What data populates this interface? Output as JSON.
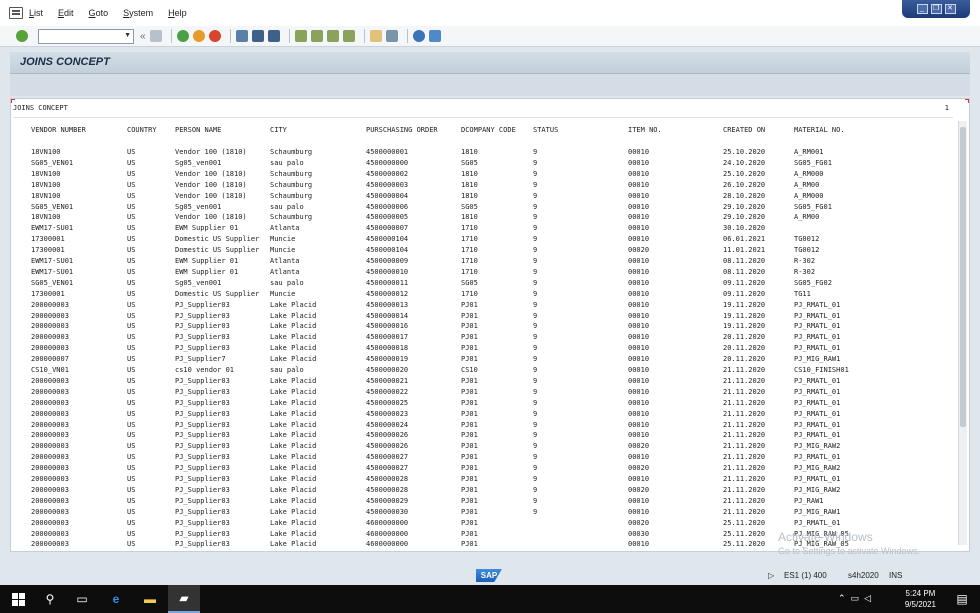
{
  "menu": [
    "List",
    "Edit",
    "Goto",
    "System",
    "Help"
  ],
  "window_controls": [
    "_",
    "❐",
    "✕"
  ],
  "page_title": "JOINS CONCEPT",
  "list": {
    "heading": "JOINS CONCEPT",
    "page_number": "1",
    "columns": [
      "VENDOR NUMBER",
      "COUNTRY",
      "PERSON NAME",
      "CITY",
      "PURSCHASING ORDER",
      "DCOMPANY CODE",
      "STATUS",
      "ITEM NO.",
      "CREATED ON",
      "MATERIAL NO."
    ],
    "rows": [
      [
        "18VN100",
        "US",
        "Vendor 100 (1810)",
        "Schaumburg",
        "4500000001",
        "1810",
        "9",
        "00010",
        "25.10.2020",
        "A_RM001"
      ],
      [
        "SG05_VEN01",
        "US",
        "Sg05_ven001",
        "sau palo",
        "4500000000",
        "SG05",
        "9",
        "00010",
        "24.10.2020",
        "SG05_FG01"
      ],
      [
        "18VN100",
        "US",
        "Vendor 100 (1810)",
        "Schaumburg",
        "4500000002",
        "1810",
        "9",
        "00010",
        "25.10.2020",
        "A_RM000"
      ],
      [
        "18VN100",
        "US",
        "Vendor 100 (1810)",
        "Schaumburg",
        "4500000003",
        "1810",
        "9",
        "00010",
        "26.10.2020",
        "A_RM00"
      ],
      [
        "18VN100",
        "US",
        "Vendor 100 (1810)",
        "Schaumburg",
        "4500000004",
        "1810",
        "9",
        "00010",
        "28.10.2020",
        "A_RM000"
      ],
      [
        "SG05_VEN01",
        "US",
        "Sg05_ven001",
        "sau palo",
        "4500000006",
        "SG05",
        "9",
        "00010",
        "29.10.2020",
        "SG05_FG01"
      ],
      [
        "18VN100",
        "US",
        "Vendor 100 (1810)",
        "Schaumburg",
        "4500000005",
        "1810",
        "9",
        "00010",
        "29.10.2020",
        "A_RM00"
      ],
      [
        "EWM17-SU01",
        "US",
        "EWM Supplier 01",
        "Atlanta",
        "4500000007",
        "1710",
        "9",
        "00010",
        "30.10.2020",
        ""
      ],
      [
        "17300001",
        "US",
        "Domestic US Supplier",
        "Muncie",
        "4500000104",
        "1710",
        "9",
        "00010",
        "06.01.2021",
        "TG0012"
      ],
      [
        "17300001",
        "US",
        "Domestic US Supplier",
        "Muncie",
        "4500000104",
        "1710",
        "9",
        "00020",
        "11.01.2021",
        "TG0012"
      ],
      [
        "EWM17-SU01",
        "US",
        "EWM Supplier 01",
        "Atlanta",
        "4500000009",
        "1710",
        "9",
        "00010",
        "08.11.2020",
        "R-302"
      ],
      [
        "EWM17-SU01",
        "US",
        "EWM Supplier 01",
        "Atlanta",
        "4500000010",
        "1710",
        "9",
        "00010",
        "08.11.2020",
        "R-302"
      ],
      [
        "SG05_VEN01",
        "US",
        "Sg05_ven001",
        "sau palo",
        "4500000011",
        "SG05",
        "9",
        "00010",
        "09.11.2020",
        "SG05_FG02"
      ],
      [
        "17300001",
        "US",
        "Domestic US Supplier",
        "Muncie",
        "4500000012",
        "1710",
        "9",
        "00010",
        "09.11.2020",
        "TG11"
      ],
      [
        "200000003",
        "US",
        "PJ_Supplier03",
        "Lake Placid",
        "4500000013",
        "PJ01",
        "9",
        "00010",
        "19.11.2020",
        "PJ_RMATL_01"
      ],
      [
        "200000003",
        "US",
        "PJ_Supplier03",
        "Lake Placid",
        "4500000014",
        "PJ01",
        "9",
        "00010",
        "19.11.2020",
        "PJ_RMATL_01"
      ],
      [
        "200000003",
        "US",
        "PJ_Supplier03",
        "Lake Placid",
        "4500000016",
        "PJ01",
        "9",
        "00010",
        "19.11.2020",
        "PJ_RMATL_01"
      ],
      [
        "200000003",
        "US",
        "PJ_Supplier03",
        "Lake Placid",
        "4500000017",
        "PJ01",
        "9",
        "00010",
        "20.11.2020",
        "PJ_RMATL_01"
      ],
      [
        "200000003",
        "US",
        "PJ_Supplier03",
        "Lake Placid",
        "4500000018",
        "PJ01",
        "9",
        "00010",
        "20.11.2020",
        "PJ_RMATL_01"
      ],
      [
        "200000007",
        "US",
        "PJ_Supplier7",
        "Lake Placid",
        "4500000019",
        "PJ01",
        "9",
        "00010",
        "20.11.2020",
        "PJ_MIG_RAW1"
      ],
      [
        "CS10_VN01",
        "US",
        "cs10 vendor 01",
        "sau palo",
        "4500000020",
        "CS10",
        "9",
        "00010",
        "21.11.2020",
        "CS10_FINISH01"
      ],
      [
        "200000003",
        "US",
        "PJ_Supplier03",
        "Lake Placid",
        "4500000021",
        "PJ01",
        "9",
        "00010",
        "21.11.2020",
        "PJ_RMATL_01"
      ],
      [
        "200000003",
        "US",
        "PJ_Supplier03",
        "Lake Placid",
        "4500000022",
        "PJ01",
        "9",
        "00010",
        "21.11.2020",
        "PJ_RMATL_01"
      ],
      [
        "200000003",
        "US",
        "PJ_Supplier03",
        "Lake Placid",
        "4500000025",
        "PJ01",
        "9",
        "00010",
        "21.11.2020",
        "PJ_RMATL_01"
      ],
      [
        "200000003",
        "US",
        "PJ_Supplier03",
        "Lake Placid",
        "4500000023",
        "PJ01",
        "9",
        "00010",
        "21.11.2020",
        "PJ_RMATL_01"
      ],
      [
        "200000003",
        "US",
        "PJ_Supplier03",
        "Lake Placid",
        "4500000024",
        "PJ01",
        "9",
        "00010",
        "21.11.2020",
        "PJ_RMATL_01"
      ],
      [
        "200000003",
        "US",
        "PJ_Supplier03",
        "Lake Placid",
        "4500000026",
        "PJ01",
        "9",
        "00010",
        "21.11.2020",
        "PJ_RMATL_01"
      ],
      [
        "200000003",
        "US",
        "PJ_Supplier03",
        "Lake Placid",
        "4500000026",
        "PJ01",
        "9",
        "00020",
        "21.11.2020",
        "PJ_MIG_RAW2"
      ],
      [
        "200000003",
        "US",
        "PJ_Supplier03",
        "Lake Placid",
        "4500000027",
        "PJ01",
        "9",
        "00010",
        "21.11.2020",
        "PJ_RMATL_01"
      ],
      [
        "200000003",
        "US",
        "PJ_Supplier03",
        "Lake Placid",
        "4500000027",
        "PJ01",
        "9",
        "00020",
        "21.11.2020",
        "PJ_MIG_RAW2"
      ],
      [
        "200000003",
        "US",
        "PJ_Supplier03",
        "Lake Placid",
        "4500000028",
        "PJ01",
        "9",
        "00010",
        "21.11.2020",
        "PJ_RMATL_01"
      ],
      [
        "200000003",
        "US",
        "PJ_Supplier03",
        "Lake Placid",
        "4500000028",
        "PJ01",
        "9",
        "00020",
        "21.11.2020",
        "PJ_MIG_RAW2"
      ],
      [
        "200000003",
        "US",
        "PJ_Supplier03",
        "Lake Placid",
        "4500000029",
        "PJ01",
        "9",
        "00010",
        "21.11.2020",
        "PJ_RAW1"
      ],
      [
        "200000003",
        "US",
        "PJ_Supplier03",
        "Lake Placid",
        "4500000030",
        "PJ01",
        "9",
        "00010",
        "21.11.2020",
        "PJ_MIG_RAW1"
      ],
      [
        "200000003",
        "US",
        "PJ_Supplier03",
        "Lake Placid",
        "4600000000",
        "PJ01",
        "",
        "00020",
        "25.11.2020",
        "PJ_RMATL_01"
      ],
      [
        "200000003",
        "US",
        "PJ_Supplier03",
        "Lake Placid",
        "4600000000",
        "PJ01",
        "",
        "00030",
        "25.11.2020",
        "PJ_MIG_RAW_05"
      ],
      [
        "200000003",
        "US",
        "PJ_Supplier03",
        "Lake Placid",
        "4600000000",
        "PJ01",
        "",
        "00010",
        "25.11.2020",
        "PJ_MIG_RAW_05"
      ]
    ]
  },
  "status_bar": {
    "sap_logo": "SAP",
    "system": "ES1 (1) 400",
    "server": "s4h2020",
    "mode": "INS"
  },
  "watermark": {
    "line1": "Activate Windows",
    "line2": "Go to Settings to activate Windows."
  },
  "taskbar": {
    "time": "5:24 PM",
    "date": "9/5/2021"
  },
  "colors": {
    "background": "#dfe6ec",
    "title_text": "#1b2d44",
    "window_controls": "#1d3a78"
  }
}
